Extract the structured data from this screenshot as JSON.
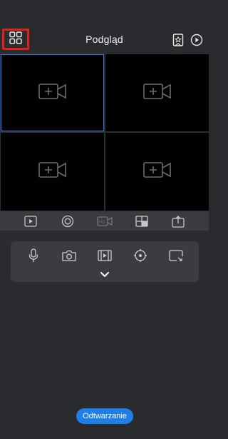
{
  "header": {
    "title": "Podgląd",
    "icons": [
      "grid-layout-icon",
      "bookmark-star-icon",
      "play-circle-icon"
    ],
    "highlight_color": "#e0201c"
  },
  "video_grid": {
    "cells": [
      {
        "icon": "add-camera-icon",
        "selected": true
      },
      {
        "icon": "add-camera-icon",
        "selected": false
      },
      {
        "icon": "add-camera-icon",
        "selected": false
      },
      {
        "icon": "add-camera-icon",
        "selected": false
      }
    ],
    "selected_border_color": "#2f7ad8"
  },
  "toolbar": {
    "icons": [
      "play-square-icon",
      "stop-record-icon",
      "hd-camera-icon",
      "split-screen-icon",
      "export-icon"
    ]
  },
  "controls": {
    "icons": [
      "microphone-icon",
      "camera-snapshot-icon",
      "video-record-icon",
      "ptz-icon",
      "fullscreen-icon"
    ],
    "expand_icon": "chevron-down-icon"
  },
  "footer": {
    "playback_label": "Odtwarzanie",
    "accent": "#1f7fe6"
  }
}
